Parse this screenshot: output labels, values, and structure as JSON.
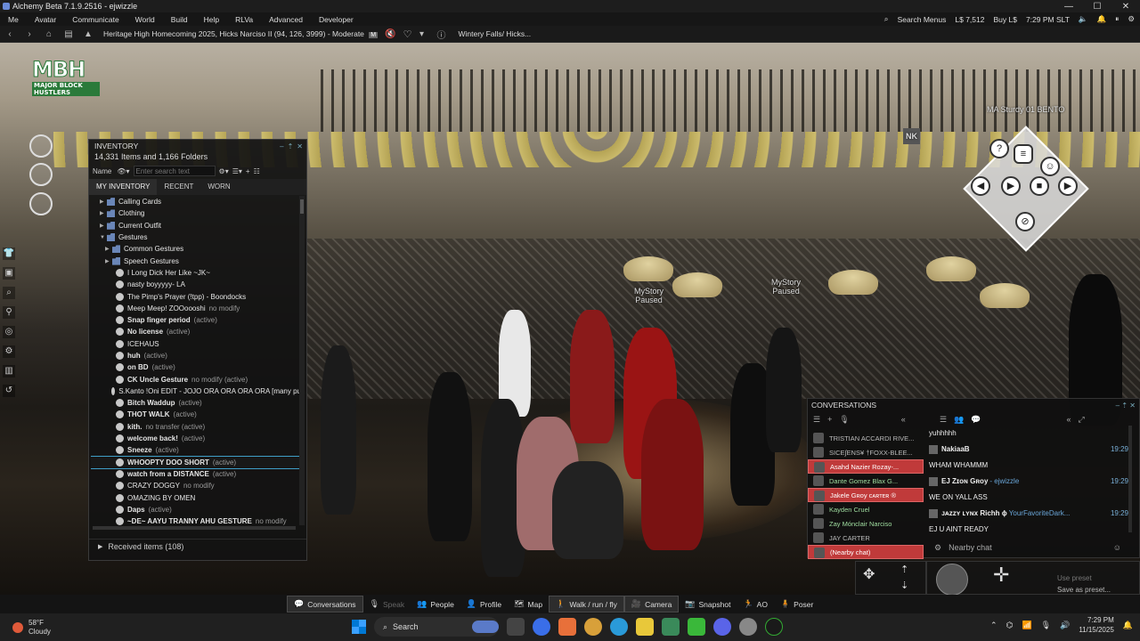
{
  "window": {
    "title": "Alchemy Beta 7.1.9.2516 - ejwizzle",
    "min": "—",
    "max": "☐",
    "close": "✕"
  },
  "menubar": {
    "items": [
      "Me",
      "Avatar",
      "Communicate",
      "World",
      "Build",
      "Help",
      "RLVa",
      "Advanced",
      "Developer"
    ],
    "search_menus": "Search Menus",
    "balance": "L$ 7,512",
    "buy": "Buy L$",
    "time": "7:29 PM SLT"
  },
  "navbar": {
    "location": "Heritage High Homecoming 2025, Hicks Narciso II (94, 126, 3999) - Moderate",
    "maturity_badge": "M",
    "parcel": "Wintery Falls/ Hicks..."
  },
  "scene": {
    "logo_main": "MBH",
    "logo_sub": "MAJOR BLOCK HUSTLERS",
    "label_sturdy": "MA Sturdy 01 BENTO",
    "label_mystory1": "MyStory\nPaused",
    "label_mystory2": "MyStory\nPaused",
    "nk_label": "NK"
  },
  "inventory": {
    "title": "INVENTORY",
    "count": "14,331 Items and 1,166 Folders",
    "sort_label": "Name",
    "search_placeholder": "Enter search text",
    "tabs": [
      "MY INVENTORY",
      "RECENT",
      "WORN"
    ],
    "items": [
      {
        "name": "Calling Cards",
        "type": "folder",
        "level": 1,
        "arrow": "▶",
        "bold": false,
        "suffix": ""
      },
      {
        "name": "Clothing",
        "type": "folder",
        "level": 1,
        "arrow": "▶",
        "bold": false,
        "suffix": ""
      },
      {
        "name": "Current Outfit",
        "type": "folder",
        "level": 1,
        "arrow": "▶",
        "bold": false,
        "suffix": ""
      },
      {
        "name": "Gestures",
        "type": "folder",
        "level": 1,
        "arrow": "▼",
        "bold": false,
        "suffix": ""
      },
      {
        "name": "Common Gestures",
        "type": "folder",
        "level": 2,
        "arrow": "▶",
        "bold": false,
        "suffix": ""
      },
      {
        "name": "Speech Gestures",
        "type": "folder",
        "level": 2,
        "arrow": "▶",
        "bold": false,
        "suffix": ""
      },
      {
        "name": "I Long Dick Her Like ~JK~",
        "type": "gesture",
        "level": 2,
        "arrow": "",
        "bold": false,
        "suffix": ""
      },
      {
        "name": "nasty boyyyyy- LA",
        "type": "gesture",
        "level": 2,
        "arrow": "",
        "bold": false,
        "suffix": ""
      },
      {
        "name": "The Pimp's Prayer (!tpp) - Boondocks",
        "type": "gesture",
        "level": 2,
        "arrow": "",
        "bold": false,
        "suffix": ""
      },
      {
        "name": "Meep Meep! ZOOoooshi",
        "type": "gesture",
        "level": 2,
        "arrow": "",
        "bold": false,
        "suffix": "no modify"
      },
      {
        "name": "Snap finger period",
        "type": "gesture",
        "level": 2,
        "arrow": "",
        "bold": true,
        "suffix": "(active)"
      },
      {
        "name": "No license",
        "type": "gesture",
        "level": 2,
        "arrow": "",
        "bold": true,
        "suffix": "(active)"
      },
      {
        "name": "ICEHAUS",
        "type": "gesture",
        "level": 2,
        "arrow": "",
        "bold": false,
        "suffix": ""
      },
      {
        "name": "huh",
        "type": "gesture",
        "level": 2,
        "arrow": "",
        "bold": true,
        "suffix": "(active)"
      },
      {
        "name": "on BD",
        "type": "gesture",
        "level": 2,
        "arrow": "",
        "bold": true,
        "suffix": "(active)"
      },
      {
        "name": "CK Uncle Gesture",
        "type": "gesture",
        "level": 2,
        "arrow": "",
        "bold": true,
        "suffix": "no modify (active)"
      },
      {
        "name": "S.Kanto !Oni EDIT - JOJO ORA ORA ORA ORA [many pu",
        "type": "gesture",
        "level": 2,
        "arrow": "",
        "bold": false,
        "suffix": ""
      },
      {
        "name": "Bitch Waddup",
        "type": "gesture",
        "level": 2,
        "arrow": "",
        "bold": true,
        "suffix": "(active)"
      },
      {
        "name": "THOT WALK",
        "type": "gesture",
        "level": 2,
        "arrow": "",
        "bold": true,
        "suffix": "(active)"
      },
      {
        "name": "kith.",
        "type": "gesture",
        "level": 2,
        "arrow": "",
        "bold": true,
        "suffix": "no transfer (active)"
      },
      {
        "name": "welcome back!",
        "type": "gesture",
        "level": 2,
        "arrow": "",
        "bold": true,
        "suffix": "(active)"
      },
      {
        "name": "Sneeze",
        "type": "gesture",
        "level": 2,
        "arrow": "",
        "bold": true,
        "suffix": "(active)"
      },
      {
        "name": "WHOOPTY DOO SHORT",
        "type": "gesture",
        "level": 2,
        "arrow": "",
        "bold": true,
        "suffix": "(active)",
        "selected": true
      },
      {
        "name": "watch from a DISTANCE",
        "type": "gesture",
        "level": 2,
        "arrow": "",
        "bold": true,
        "suffix": "(active)"
      },
      {
        "name": "CRAZY DOGGY",
        "type": "gesture",
        "level": 2,
        "arrow": "",
        "bold": false,
        "suffix": "no modify"
      },
      {
        "name": "OMAZING BY OMEN",
        "type": "gesture",
        "level": 2,
        "arrow": "",
        "bold": false,
        "suffix": ""
      },
      {
        "name": "Daps",
        "type": "gesture",
        "level": 2,
        "arrow": "",
        "bold": true,
        "suffix": "(active)"
      },
      {
        "name": "~DE~ AAYU TRANNY AHU GESTURE",
        "type": "gesture",
        "level": 2,
        "arrow": "",
        "bold": true,
        "suffix": "no modify"
      }
    ],
    "received": "Received items (108)"
  },
  "conversations": {
    "title": "CONVERSATIONS",
    "list": [
      {
        "name": "TRISTIAN ACCARDI RIVE...",
        "style": "dim"
      },
      {
        "name": "SICE∫ENS¥ †FOXX-BLEE...",
        "style": "dim"
      },
      {
        "name": "Asahd Nazier Rozay-...",
        "style": "red"
      },
      {
        "name": "Dante Gomez Blax G...",
        "style": "green"
      },
      {
        "name": "Jakele Gʀoy ᴄᴀʀᴛᴇʀ ®",
        "style": "red"
      },
      {
        "name": "Kayden Cruel",
        "style": "green"
      },
      {
        "name": "Zay Mónclair Narciso",
        "style": "green"
      },
      {
        "name": "JAY CARTER",
        "style": "dim"
      },
      {
        "name": "(Nearby chat)",
        "style": "red"
      }
    ],
    "messages": [
      {
        "name": "",
        "text": "yuhhhhh",
        "time": ""
      },
      {
        "name": "NakiaaB",
        "text": "",
        "time": "19:29"
      },
      {
        "name": "",
        "text": "WHAM WHAMMM",
        "time": ""
      },
      {
        "name": "EJ Zɪᴏɴ Gʀoy",
        "text": "- ejwizzle",
        "time": "19:29"
      },
      {
        "name": "",
        "text": "WE ON YALL ASS",
        "time": ""
      },
      {
        "name": "ᴊᴀᴢᴢʏ ʟʏɴx Richh ϕ",
        "text": "YourFavoriteDark...",
        "time": "19:29"
      },
      {
        "name": "",
        "text": "EJ U AINT READY",
        "time": ""
      }
    ],
    "input_placeholder": "Nearby chat"
  },
  "controls": {
    "use_preset": "Use preset",
    "save_preset": "Save as preset..."
  },
  "bottombar": {
    "buttons": [
      {
        "label": "Conversations",
        "state": "active",
        "icon": "💬"
      },
      {
        "label": "Speak",
        "state": "disabled",
        "icon": "🎙"
      },
      {
        "label": "People",
        "state": "normal",
        "icon": "👥"
      },
      {
        "label": "Profile",
        "state": "normal",
        "icon": "👤"
      },
      {
        "label": "Map",
        "state": "normal",
        "icon": "🗺"
      },
      {
        "label": "Walk / run / fly",
        "state": "active",
        "icon": "🚶"
      },
      {
        "label": "Camera",
        "state": "active",
        "icon": "🎥"
      },
      {
        "label": "Snapshot",
        "state": "normal",
        "icon": "📷"
      },
      {
        "label": "AO",
        "state": "normal",
        "icon": "🏃"
      },
      {
        "label": "Poser",
        "state": "normal",
        "icon": "🧍"
      }
    ]
  },
  "taskbar": {
    "temp": "58°F",
    "condition": "Cloudy",
    "search": "Search",
    "time": "7:29 PM",
    "date": "11/15/2025"
  }
}
